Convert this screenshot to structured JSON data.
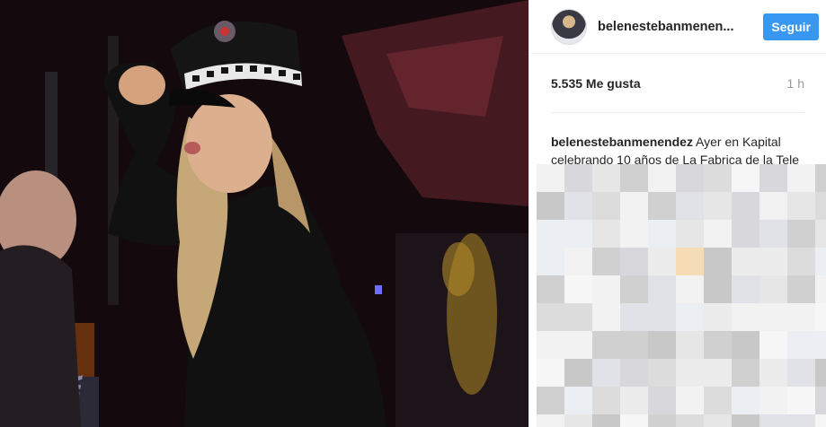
{
  "post": {
    "username": "belenestebanmenen...",
    "follow_label": "Seguir",
    "likes": "5.535 Me gusta",
    "time": "1 h",
    "caption_author": "belenestebanmenendez",
    "caption_text": " Ayer en Kapital celebrando 10 años de La Fabrica de la Tele me lo pasé genial"
  },
  "colors": {
    "accent": "#3897f0",
    "border": "#efefef",
    "muted": "#999999"
  },
  "icons": {
    "avatar": "profile-photo",
    "comments": "pixelated-comments"
  }
}
